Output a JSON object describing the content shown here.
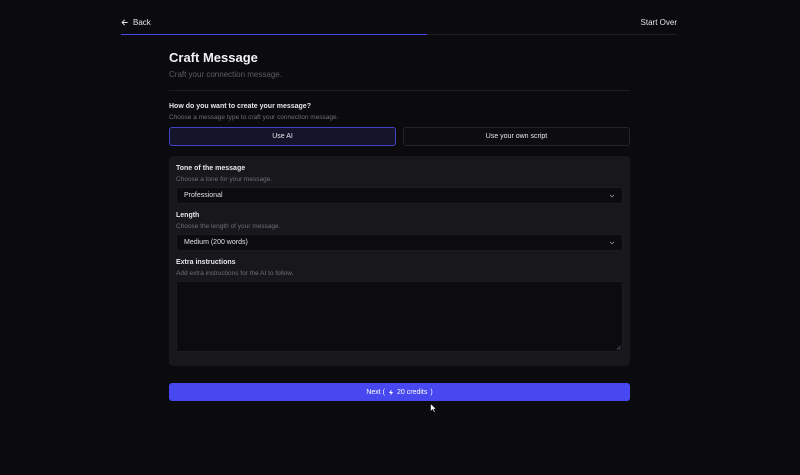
{
  "topbar": {
    "back_label": "Back",
    "start_over_label": "Start Over"
  },
  "progress": {
    "fraction": 0.55
  },
  "header": {
    "title": "Craft Message",
    "subtitle": "Craft your connection message."
  },
  "message_type": {
    "question": "How do you want to create your message?",
    "hint": "Choose a message type to craft your connection message.",
    "options": [
      {
        "label": "Use AI",
        "selected": true
      },
      {
        "label": "Use your own script",
        "selected": false
      }
    ]
  },
  "tone": {
    "label": "Tone of the message",
    "hint": "Choose a tone for your message.",
    "value": "Professional"
  },
  "length": {
    "label": "Length",
    "hint": "Choose the length of your message.",
    "value": "Medium (200 words)"
  },
  "extra": {
    "label": "Extra instructions",
    "hint": "Add extra instructions for the AI to follow.",
    "value": ""
  },
  "next_button": {
    "label_prefix": "Next (",
    "credits": "20 credits",
    "label_suffix": ")"
  },
  "colors": {
    "accent": "#4848f0",
    "background": "#0b0a0d",
    "panel": "#18171c"
  }
}
